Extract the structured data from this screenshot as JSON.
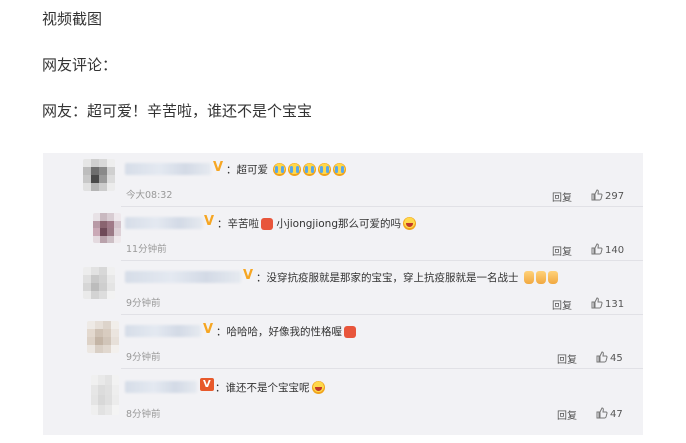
{
  "intro": {
    "line1": "视频截图",
    "line2": "网友评论：",
    "line3": "网友：超可爱！辛苦啦，谁还不是个宝宝"
  },
  "comments": [
    {
      "text": "：超可爱",
      "time": "今大08:32",
      "reply": "回复",
      "likes": "297"
    },
    {
      "text_a": "：辛苦啦",
      "text_b": "小jiongjiong那么可爱的吗",
      "time": "11分钟前",
      "reply": "回复",
      "likes": "140"
    },
    {
      "text": "：没穿抗疫服就是那家的宝宝，穿上抗疫服就是一名战士",
      "time": "9分钟前",
      "reply": "回复",
      "likes": "131"
    },
    {
      "text": "：哈哈哈，好像我的性格喔",
      "time": "9分钟前",
      "reply": "回复",
      "likes": "45"
    },
    {
      "text": "：谁还不是个宝宝呢",
      "time": "8分钟前",
      "reply": "回复",
      "likes": "47"
    }
  ],
  "badges": {
    "vip": "V"
  },
  "icons": {
    "like": "thumbs-up-icon",
    "emoji_cry": "crying-face-icon",
    "emoji_laugh": "laughing-face-icon",
    "emoji_thumb": "thumb-emoji-icon",
    "emoji_fight": "fighting-emoji-icon"
  },
  "colors": {
    "card_bg": "#f2f2f5",
    "vip_badge": "#f6a623",
    "vip_red": "#e7592b",
    "time_text": "#999999"
  }
}
